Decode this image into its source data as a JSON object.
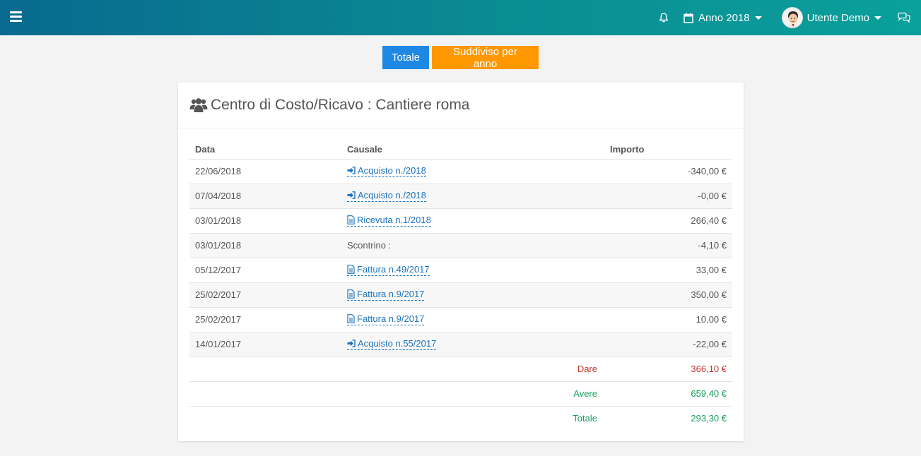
{
  "topbar": {
    "year_label": "Anno 2018",
    "user_label": "Utente Demo"
  },
  "toggle": {
    "totale_label": "Totale",
    "anno_label": "Suddiviso per anno"
  },
  "card": {
    "title": "Centro di Costo/Ricavo : Cantiere roma"
  },
  "table": {
    "headers": {
      "data": "Data",
      "causale": "Causale",
      "importo": "Importo"
    },
    "rows": [
      {
        "data": "22/06/2018",
        "causale": "Acquisto n./2018",
        "icon": "sign-in-icon",
        "importo": "-340,00 €"
      },
      {
        "data": "07/04/2018",
        "causale": "Acquisto n./2018",
        "icon": "sign-in-icon",
        "importo": "-0,00 €"
      },
      {
        "data": "03/01/2018",
        "causale": "Ricevuta n.1/2018",
        "icon": "document-icon",
        "importo": "266,40 €"
      },
      {
        "data": "03/01/2018",
        "causale": "Scontrino :",
        "icon": "",
        "importo": "-4,10 €"
      },
      {
        "data": "05/12/2017",
        "causale": "Fattura n.49/2017",
        "icon": "document-icon",
        "importo": "33,00 €"
      },
      {
        "data": "25/02/2017",
        "causale": "Fattura n.9/2017",
        "icon": "document-icon",
        "importo": "350,00 €"
      },
      {
        "data": "25/02/2017",
        "causale": "Fattura n.9/2017",
        "icon": "document-icon",
        "importo": "10,00 €"
      },
      {
        "data": "14/01/2017",
        "causale": "Acquisto n.55/2017",
        "icon": "sign-in-icon",
        "importo": "-22,00 €"
      }
    ],
    "summary": {
      "dare_label": "Dare",
      "dare_value": "366,10 €",
      "avere_label": "Avere",
      "avere_value": "659,40 €",
      "totale_label": "Totale",
      "totale_value": "293,30 €"
    }
  },
  "colors": {
    "topbar_start": "#086a8f",
    "topbar_end": "#0aa09b",
    "primary_button": "#1e88e5",
    "orange_button": "#ff9800",
    "link": "#1e73be",
    "negative": "#c0392b",
    "positive": "#16a05d"
  }
}
